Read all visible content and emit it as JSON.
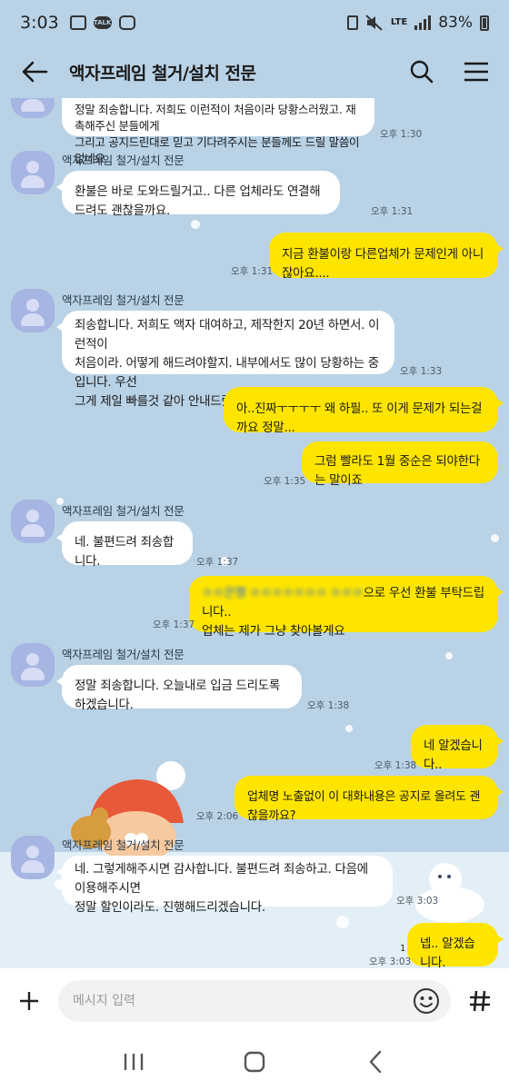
{
  "status_bar": {
    "time": "3:03",
    "talk_label": "TALK",
    "network": "LTE",
    "battery": "83%"
  },
  "header": {
    "title": "액자프레임 철거/설치 전문"
  },
  "messages": [
    {
      "text": "정말 죄송합니다. 저희도 이런적이 처음이라 당황스러웠고. 재촉해주신 분들에게\n그리고 공지드린대로 믿고 기다려주시는 분들께도 드릴 말씀이 없네요..",
      "time": "오후 1:30"
    },
    {
      "sender": "액자프레임 철거/설치 전문",
      "text": "환불은 바로 도와드릴거고.. 다른 업체라도 연결해 드려도 괜찮을까요.",
      "time": "오후 1:31"
    },
    {
      "text": "지금 환불이랑 다른업체가 문제인게 아니잖아요....",
      "time": "오후 1:31"
    },
    {
      "sender": "액자프레임 철거/설치 전문",
      "text": "죄송합니다. 저희도 액자 대여하고, 제작한지 20년 하면서. 이런적이\n처음이라. 어떻게 해드려야할지. 내부에서도 많이 당황하는 중입니다. 우선\n그게 제일 빠를것 같아 안내드렸습니다.",
      "time": "오후 1:33"
    },
    {
      "text": "아..진짜ㅜㅜㅜㅜ 왜 하필.. 또 이게 문제가 되는걸까요 정말...",
      "time": ""
    },
    {
      "text": "그럼 빨라도 1월 중순은 되야한다는 말이죠",
      "time": "오후 1:35"
    },
    {
      "sender": "액자프레임 철거/설치 전문",
      "text": "네. 불편드려 죄송합니다.",
      "time": "오후 1:37"
    },
    {
      "text_hidden": "ㅇㅇ은행 ㅇㅇㅇㅇㅇㅇㅇ ㅇㅇㅇ",
      "text_visible": "으로 우선 환불 부탁드립니다..",
      "text_line2": "업체는 제가 그냥 찾아볼게요",
      "time": "오후 1:37"
    },
    {
      "sender": "액자프레임 철거/설치 전문",
      "text": "정말 죄송합니다. 오늘내로 입금 드리도록 하겠습니다.",
      "time": "오후 1:38"
    },
    {
      "text": "네 알겠습니다..",
      "time": "오후 1:38"
    },
    {
      "text": "업체명 노출없이 이 대화내용은 공지로 올려도 괜찮을까요?",
      "time": "오후 2:06"
    },
    {
      "sender": "액자프레임 철거/설치 전문",
      "text": "네. 그렇게해주시면 감사합니다. 불편드려 죄송하고. 다음에 이용해주시면\n정말 할인이라도. 진행해드리겠습니다.",
      "time": "오후 3:03"
    },
    {
      "text": "넵.. 알겠습니다.",
      "time": "오후 3:03",
      "unread": "1"
    }
  ],
  "input": {
    "placeholder": "메시지 입력"
  },
  "colors": {
    "background": "#b9d2e6",
    "my_bubble": "#fee500",
    "other_bubble": "#ffffff",
    "avatar": "#a7b5e3"
  }
}
